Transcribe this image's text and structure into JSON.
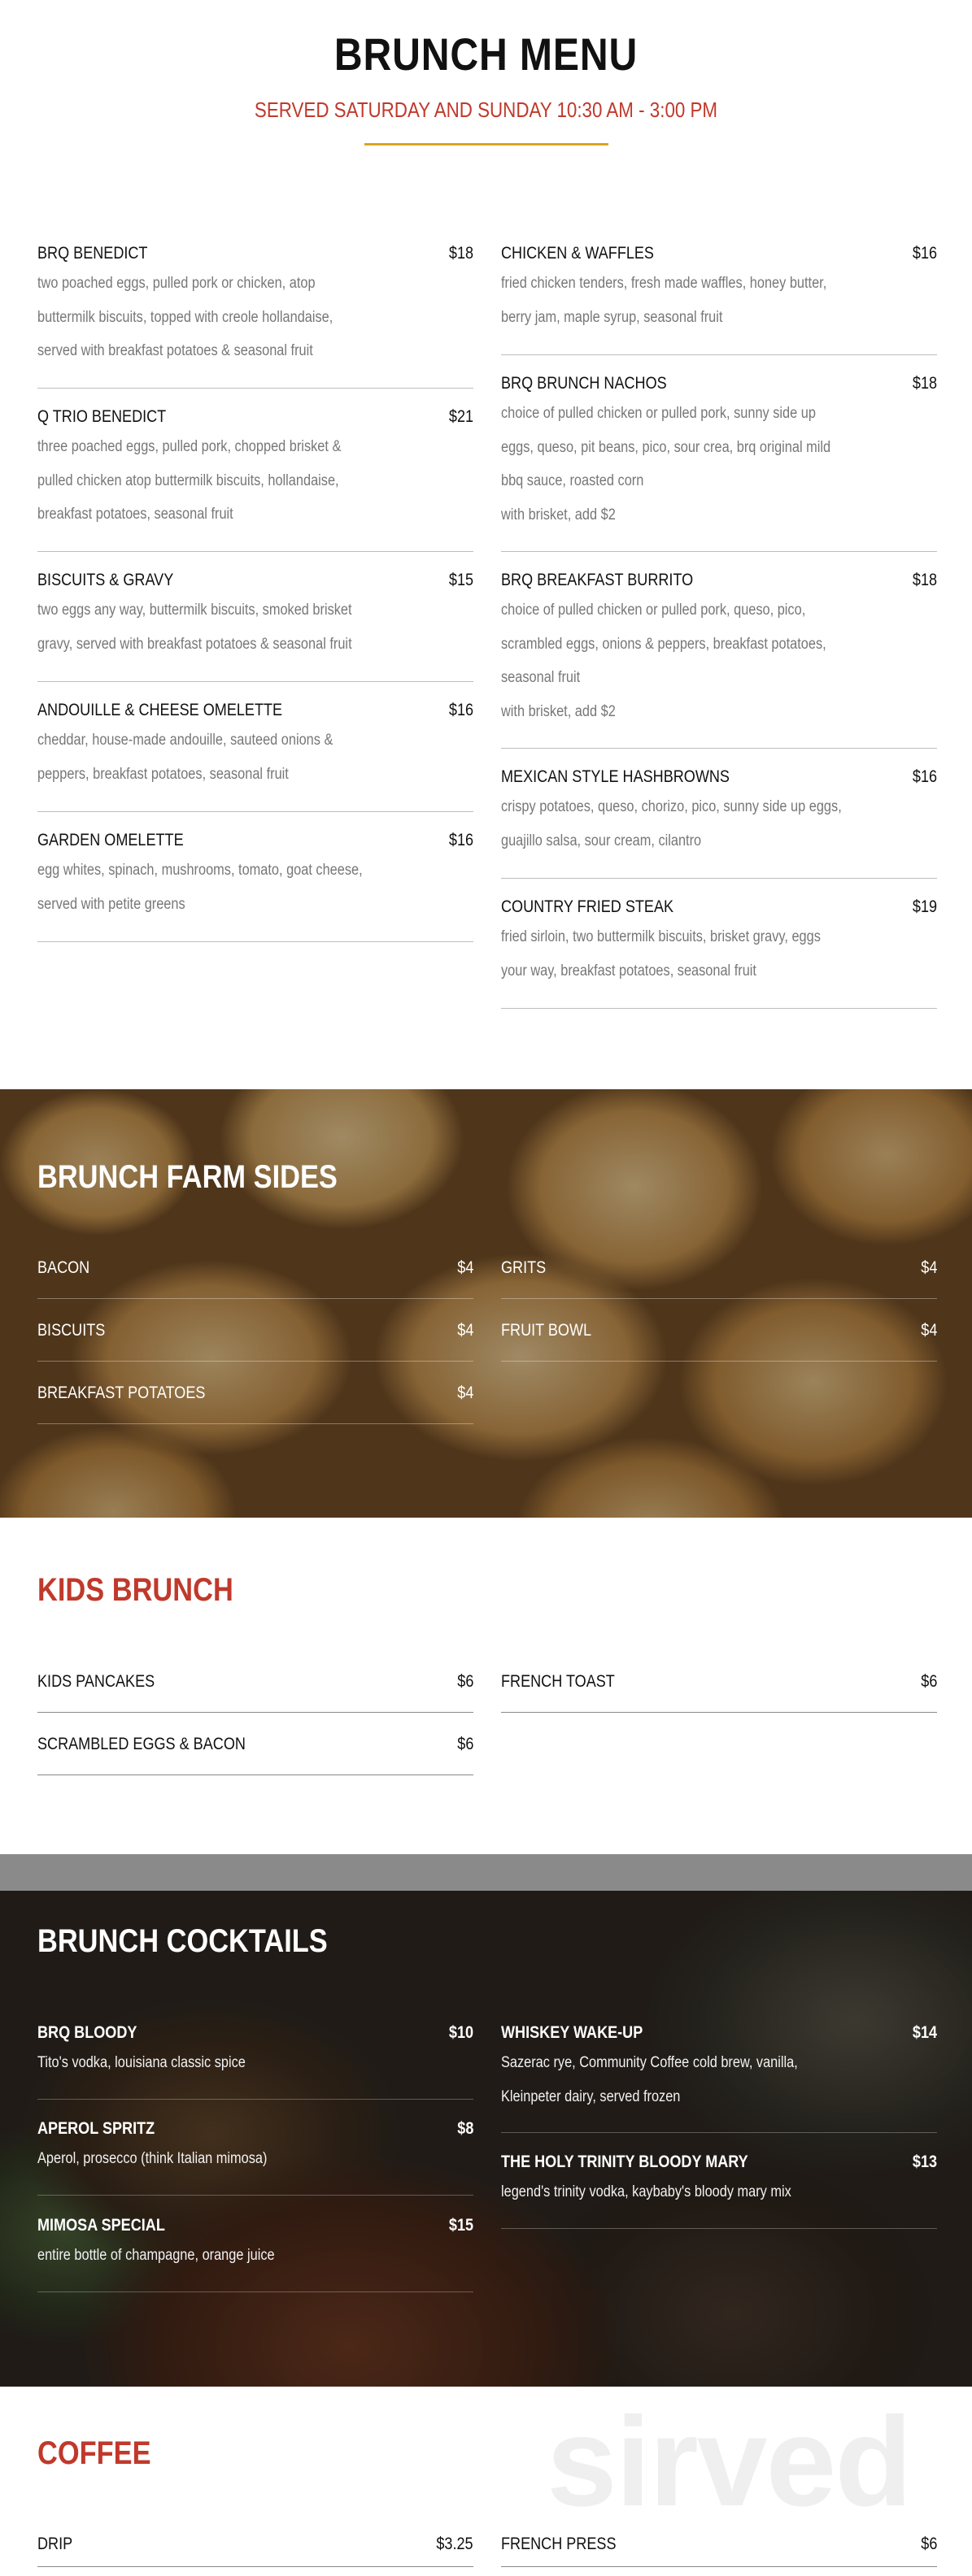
{
  "header": {
    "title": "BRUNCH MENU",
    "subtitle": "SERVED SATURDAY AND SUNDAY 10:30 AM - 3:00 PM"
  },
  "brunch": {
    "left": [
      {
        "name": "BRQ BENEDICT",
        "price": "$18",
        "desc": "two poached eggs, pulled pork or chicken, atop\nbuttermilk biscuits, topped with creole hollandaise,\nserved with breakfast potatoes & seasonal fruit"
      },
      {
        "name": "Q TRIO BENEDICT",
        "price": "$21",
        "desc": "three poached eggs, pulled pork, chopped brisket &\npulled chicken atop buttermilk biscuits, hollandaise,\nbreakfast potatoes, seasonal fruit"
      },
      {
        "name": "BISCUITS & GRAVY",
        "price": "$15",
        "desc": "two eggs any way, buttermilk biscuits, smoked brisket\ngravy, served with breakfast potatoes & seasonal fruit"
      },
      {
        "name": "ANDOUILLE & CHEESE OMELETTE",
        "price": "$16",
        "desc": "cheddar, house-made andouille, sauteed onions &\npeppers, breakfast potatoes, seasonal fruit"
      },
      {
        "name": "GARDEN OMELETTE",
        "price": "$16",
        "desc": "egg whites, spinach, mushrooms, tomato, goat cheese,\nserved with petite greens"
      }
    ],
    "right": [
      {
        "name": "CHICKEN & WAFFLES",
        "price": "$16",
        "desc": "fried chicken tenders, fresh made waffles, honey butter,\nberry jam, maple syrup, seasonal fruit"
      },
      {
        "name": "BRQ BRUNCH NACHOS",
        "price": "$18",
        "desc": "choice of pulled chicken or pulled pork, sunny side up\neggs, queso, pit beans, pico, sour crea, brq original mild\nbbq sauce, roasted corn\nwith brisket, add $2"
      },
      {
        "name": "BRQ BREAKFAST BURRITO",
        "price": "$18",
        "desc": "choice of pulled chicken or pulled pork, queso, pico,\nscrambled eggs, onions & peppers, breakfast potatoes,\nseasonal fruit\nwith brisket, add $2"
      },
      {
        "name": "MEXICAN STYLE HASHBROWNS",
        "price": "$16",
        "desc": "crispy potatoes, queso, chorizo, pico, sunny side up eggs,\nguajillo salsa, sour cream, cilantro"
      },
      {
        "name": "COUNTRY FRIED STEAK",
        "price": "$19",
        "desc": "fried sirloin, two buttermilk biscuits, brisket gravy, eggs\nyour way, breakfast potatoes, seasonal fruit"
      }
    ]
  },
  "sides": {
    "heading": "BRUNCH FARM SIDES",
    "left": [
      {
        "name": "BACON",
        "price": "$4"
      },
      {
        "name": "BISCUITS",
        "price": "$4"
      },
      {
        "name": "BREAKFAST POTATOES",
        "price": "$4"
      }
    ],
    "right": [
      {
        "name": "GRITS",
        "price": "$4"
      },
      {
        "name": "FRUIT BOWL",
        "price": "$4"
      }
    ]
  },
  "kids": {
    "heading": "KIDS BRUNCH",
    "left": [
      {
        "name": "KIDS PANCAKES",
        "price": "$6"
      },
      {
        "name": "SCRAMBLED EGGS & BACON",
        "price": "$6"
      }
    ],
    "right": [
      {
        "name": "FRENCH TOAST",
        "price": "$6"
      }
    ]
  },
  "cocktails": {
    "heading": "BRUNCH COCKTAILS",
    "left": [
      {
        "name": "BRQ BLOODY",
        "price": "$10",
        "desc": "Tito's vodka, louisiana classic spice"
      },
      {
        "name": "APEROL SPRITZ",
        "price": "$8",
        "desc": "Aperol, prosecco (think Italian mimosa)"
      },
      {
        "name": "MIMOSA SPECIAL",
        "price": "$15",
        "desc": "entire bottle of champagne, orange juice"
      }
    ],
    "right": [
      {
        "name": "WHISKEY WAKE-UP",
        "price": "$14",
        "desc": "Sazerac rye, Community Coffee cold brew, vanilla,\nKleinpeter dairy, served frozen"
      },
      {
        "name": "THE HOLY TRINITY BLOODY MARY",
        "price": "$13",
        "desc": "legend's trinity vodka, kaybaby's bloody mary mix"
      }
    ]
  },
  "coffee": {
    "heading": "COFFEE",
    "left": [
      {
        "name": "DRIP",
        "price": "$3.25"
      }
    ],
    "right": [
      {
        "name": "FRENCH PRESS",
        "price": "$6"
      }
    ]
  },
  "watermark": "sirved",
  "colors": {
    "accent_red": "#c0392b",
    "rule_gold": "#d9a520"
  }
}
